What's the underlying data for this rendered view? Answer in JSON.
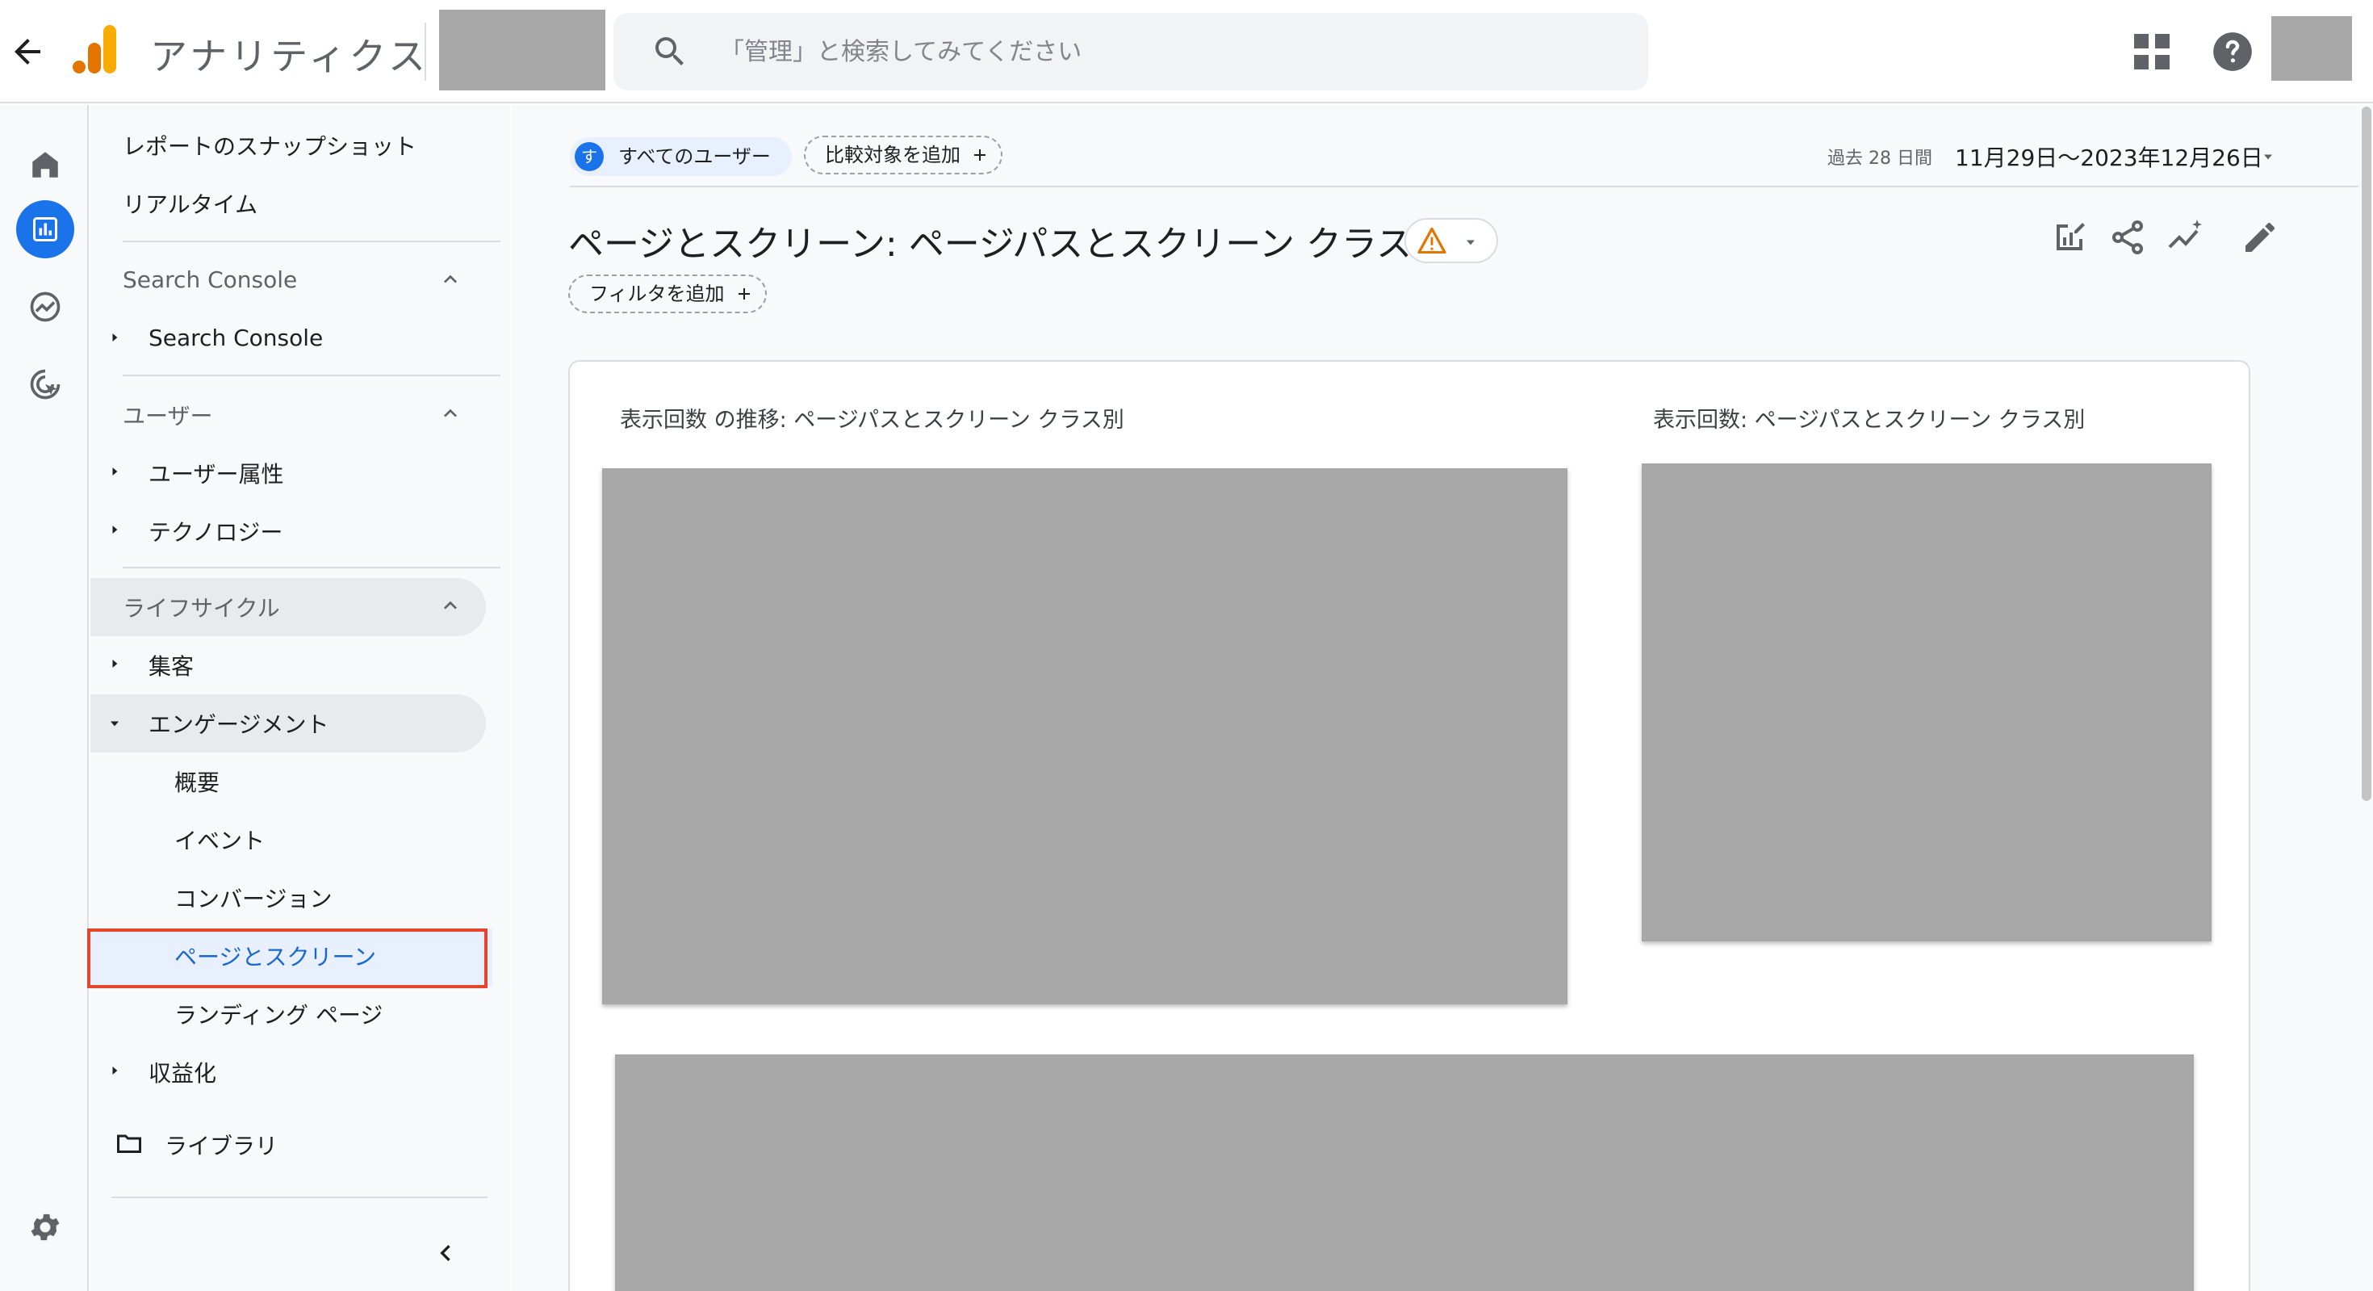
{
  "topbar": {
    "app_title": "アナリティクス",
    "search_placeholder": "「管理」と検索してみてください"
  },
  "sidenav": {
    "report_snapshot": "レポートのスナップショット",
    "realtime": "リアルタイム",
    "sections": {
      "search_console": {
        "title": "Search Console",
        "items": [
          "Search Console"
        ]
      },
      "user": {
        "title": "ユーザー",
        "items": [
          "ユーザー属性",
          "テクノロジー"
        ]
      },
      "lifecycle": {
        "title": "ライフサイクル",
        "acquisition": "集客",
        "engagement": "エンゲージメント",
        "engagement_children": [
          "概要",
          "イベント",
          "コンバージョン",
          "ページとスクリーン",
          "ランディング ページ"
        ],
        "monetization": "収益化"
      }
    },
    "library": "ライブラリ"
  },
  "main": {
    "segment_chip": {
      "avatar_letter": "す",
      "label": "すべてのユーザー"
    },
    "add_comparison": "比較対象を追加",
    "date_prefix": "過去 28 日間",
    "date_range": "11月29日～2023年12月26日",
    "page_title": "ページとスクリーン: ページパスとスクリーン クラス",
    "add_filter": "フィルタを追加",
    "chart_left_title": "表示回数 の推移: ページパスとスクリーン クラス別",
    "chart_right_title": "表示回数: ページパスとスクリーン クラス別"
  },
  "colors": {
    "accent": "#1a73e8",
    "highlight_border": "#e5452c",
    "active_item_bg": "#e8f0fe",
    "redacted": "#a8a8a8",
    "warning": "#e37400"
  }
}
